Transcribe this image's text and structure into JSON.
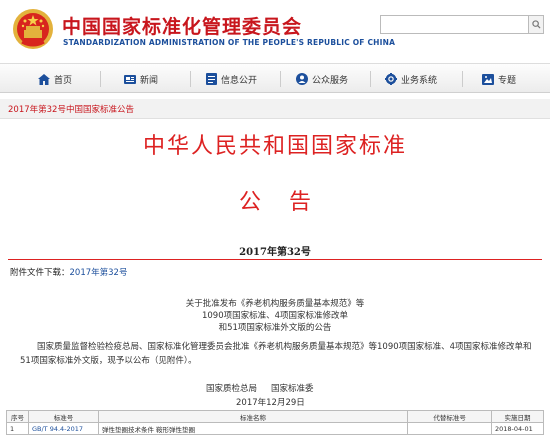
{
  "header": {
    "title": "中国国家标准化管理委员会",
    "subtitle": "STANDARDIZATION ADMINISTRATION OF THE PEOPLE'S REPUBLIC OF CHINA"
  },
  "nav": {
    "items": [
      {
        "label": "首页",
        "icon": "home-icon"
      },
      {
        "label": "新闻",
        "icon": "news-icon"
      },
      {
        "label": "信息公开",
        "icon": "info-icon"
      },
      {
        "label": "公众服务",
        "icon": "public-service-icon"
      },
      {
        "label": "业务系统",
        "icon": "business-system-icon"
      },
      {
        "label": "专题",
        "icon": "topic-icon"
      }
    ]
  },
  "breadcrumb": "2017年第32号中国国家标准公告",
  "document": {
    "main_title": "中华人民共和国国家标准",
    "notice_title": "公告",
    "number": "2017年第32号",
    "attachment_label": "附件文件下载：",
    "attachment_link": "2017年第32号",
    "subject_lines": [
      "关于批准发布《养老机构服务质量基本规范》等",
      "1090项国家标准、4项国家标准修改单",
      "和51项国家标准外文版的公告"
    ],
    "body": "国家质量监督检验检疫总局、国家标准化管理委员会批准《养老机构服务质量基本规范》等1090项国家标准、4项国家标准修改单和51项国家标准外文版，现予以公布（见附件）。",
    "signatories": [
      "国家质检总局",
      "国家标准委"
    ],
    "date": "2017年12月29日"
  },
  "table": {
    "headers": [
      "序号",
      "标准号",
      "标准名称",
      "代替标准号",
      "实施日期"
    ],
    "rows": [
      [
        "1",
        "GB/T 94.4-2017",
        "弹性垫圈技术条件 鞍形弹性垫圈",
        "",
        "2018-04-01"
      ]
    ]
  },
  "colors": {
    "brand_red": "#c8161d",
    "brand_blue": "#1c4f9c",
    "title_red": "#dd2222"
  }
}
